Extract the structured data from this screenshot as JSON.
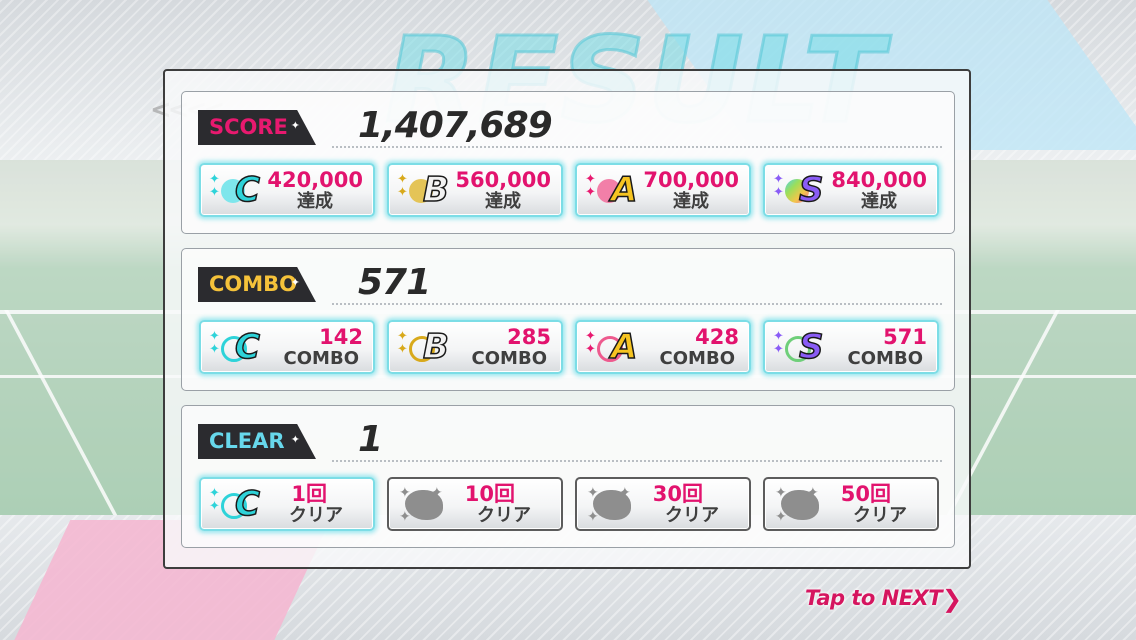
{
  "background": {
    "deco_title": "RESULT"
  },
  "sections": [
    {
      "id": "score",
      "label": "SCORE",
      "label_color": "#e8196f",
      "value": "1,407,689",
      "tiles": [
        {
          "rank": "C",
          "rank_color": "#2ed3d9",
          "line1": "420,000",
          "line2": "達成",
          "achieved": true
        },
        {
          "rank": "B",
          "rank_color": "#f2f2f2",
          "line1": "560,000",
          "line2": "達成",
          "achieved": true
        },
        {
          "rank": "A",
          "rank_color": "#f6c421",
          "line1": "700,000",
          "line2": "達成",
          "achieved": true
        },
        {
          "rank": "S",
          "rank_color": "#8a5cf6",
          "line1": "840,000",
          "line2": "達成",
          "achieved": true
        }
      ]
    },
    {
      "id": "combo",
      "label": "COMBO",
      "label_color": "#f5c23a",
      "value": "571",
      "tiles": [
        {
          "rank": "C",
          "rank_color": "#2ed3d9",
          "line1": "142",
          "line2": "COMBO",
          "achieved": true
        },
        {
          "rank": "B",
          "rank_color": "#f2f2f2",
          "line1": "285",
          "line2": "COMBO",
          "achieved": true
        },
        {
          "rank": "A",
          "rank_color": "#f6c421",
          "line1": "428",
          "line2": "COMBO",
          "achieved": true
        },
        {
          "rank": "S",
          "rank_color": "#8a5cf6",
          "line1": "571",
          "line2": "COMBO",
          "achieved": true
        }
      ]
    },
    {
      "id": "clear",
      "label": "CLEAR",
      "label_color": "#67d8ec",
      "value": "1",
      "tiles": [
        {
          "rank": "C",
          "rank_color": "#2ed3d9",
          "line1": "1回",
          "line2": "クリア",
          "achieved": true
        },
        {
          "rank": "",
          "rank_color": "#8e8e8e",
          "line1": "10回",
          "line2": "クリア",
          "achieved": false
        },
        {
          "rank": "",
          "rank_color": "#8e8e8e",
          "line1": "30回",
          "line2": "クリア",
          "achieved": false
        },
        {
          "rank": "",
          "rank_color": "#8e8e8e",
          "line1": "50回",
          "line2": "クリア",
          "achieved": false
        }
      ]
    }
  ],
  "footer": {
    "tap_next": "Tap to NEXT",
    "arrow_icon": "chevron-right-icon"
  }
}
